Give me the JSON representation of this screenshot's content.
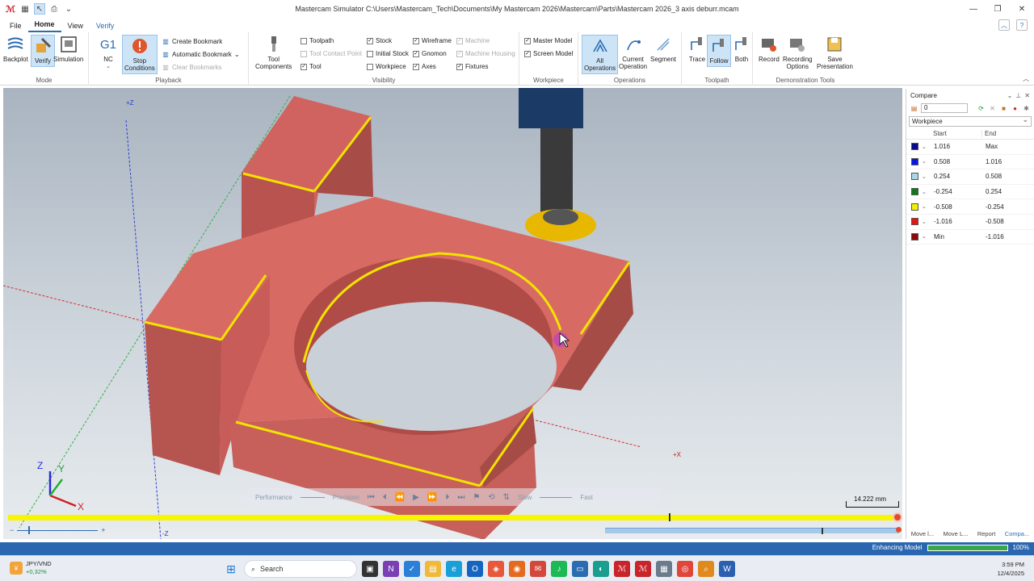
{
  "window": {
    "title": "Mastercam Simulator  C:\\Users\\Mastercam_Tech\\Documents\\My Mastercam 2026\\Mastercam\\Parts\\Mastercam 2026_3 axis deburr.mcam",
    "minimize": "—",
    "maximize": "❐",
    "close": "✕"
  },
  "menu": {
    "tabs": [
      "File",
      "Home",
      "View",
      "Verify"
    ],
    "active": "Home"
  },
  "ribbon": {
    "mode": {
      "label": "Mode",
      "backplot": "Backplot",
      "verify": "Verify",
      "simulation": "Simulation"
    },
    "playback": {
      "label": "Playback",
      "nc_icon": "G1",
      "nc": "NC",
      "stop_conditions_1": "Stop",
      "stop_conditions_2": "Conditions",
      "create_bookmark": "Create Bookmark",
      "automatic_bookmark": "Automatic Bookmark",
      "clear_bookmarks": "Clear Bookmarks"
    },
    "visibility": {
      "label": "Visibility",
      "tool_components_1": "Tool",
      "tool_components_2": "Components",
      "toolpath": "Toolpath",
      "tool_contact_point": "Tool Contact Point",
      "tool": "Tool",
      "stock": "Stock",
      "initial_stock": "Initial Stock",
      "workpiece": "Workpiece",
      "wireframe": "Wireframe",
      "gnomon": "Gnomon",
      "axes": "Axes",
      "machine": "Machine",
      "machine_housing": "Machine Housing",
      "fixtures": "Fixtures"
    },
    "workpiece": {
      "label": "Workpiece",
      "master_model": "Master Model",
      "screen_model": "Screen Model"
    },
    "operations": {
      "label": "Operations",
      "all_1": "All",
      "all_2": "Operations",
      "current_1": "Current",
      "current_2": "Operation",
      "segment": "Segment"
    },
    "toolpath": {
      "label": "Toolpath",
      "trace": "Trace",
      "follow": "Follow",
      "both": "Both"
    },
    "demo": {
      "label": "Demonstration Tools",
      "record": "Record",
      "recording_options_1": "Recording",
      "recording_options_2": "Options",
      "save_presentation_1": "Save",
      "save_presentation_2": "Presentation"
    }
  },
  "viewport": {
    "axis_plus_z": "+Z",
    "axis_minus_z": "-Z",
    "axis_plus_x": "+X",
    "gnomon_z": "Z",
    "gnomon_y": "Y",
    "gnomon_x": "X",
    "scale": "14.222 mm",
    "performance": "Performance",
    "precision": "Precision",
    "slow": "Slow",
    "fast": "Fast",
    "zoom_minus": "−",
    "zoom_plus": "+"
  },
  "compare": {
    "title": "Compare",
    "value": "0",
    "select": "Workpiece",
    "col_start": "Start",
    "col_end": "End",
    "rows": [
      {
        "color": "#0a0a8c",
        "start": "1.016",
        "end": "Max"
      },
      {
        "color": "#0a14e6",
        "start": "0.508",
        "end": "1.016"
      },
      {
        "color": "#a8d8e8",
        "start": "0.254",
        "end": "0.508"
      },
      {
        "color": "#0f7a1a",
        "start": "-0.254",
        "end": "0.254"
      },
      {
        "color": "#f2f200",
        "start": "-0.508",
        "end": "-0.254"
      },
      {
        "color": "#e61414",
        "start": "-1.016",
        "end": "-0.508"
      },
      {
        "color": "#8c0a0a",
        "start": "Min",
        "end": "-1.016"
      }
    ],
    "tabs": [
      "Move l...",
      "Move L...",
      "Report",
      "Compa..."
    ]
  },
  "status": {
    "enhancing": "Enhancing Model",
    "progress_pct": 100,
    "progress_text": "100%"
  },
  "taskbar": {
    "ticker": "JPY/VND",
    "ticker_change": "+0,32%",
    "search": "Search",
    "time": "3:59 PM",
    "date": "12/4/2025"
  }
}
